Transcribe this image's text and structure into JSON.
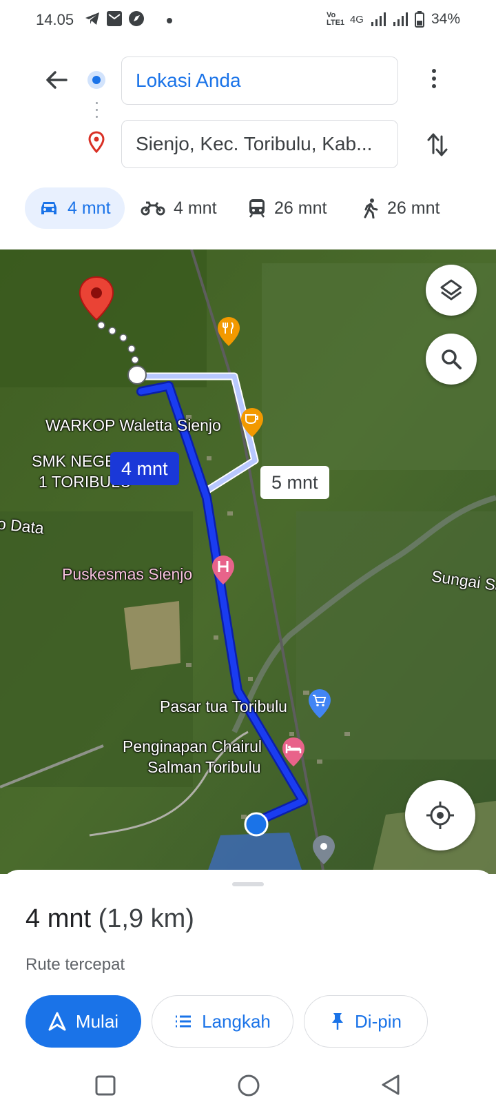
{
  "status_bar": {
    "time": "14.05",
    "network_label": "4G",
    "volte_label": "Vo LTE1",
    "battery": "34%"
  },
  "header": {
    "origin_value": "Lokasi Anda",
    "destination_value": "Sienjo, Kec. Toribulu, Kab..."
  },
  "modes": [
    {
      "icon": "car-icon",
      "label": "4 mnt",
      "active": true
    },
    {
      "icon": "motorcycle-icon",
      "label": "4 mnt",
      "active": false
    },
    {
      "icon": "train-icon",
      "label": "26 mnt",
      "active": false
    },
    {
      "icon": "walk-icon",
      "label": "26 mnt",
      "active": false
    }
  ],
  "map": {
    "labels": {
      "warkop": "WARKOP Waletta Sienjo",
      "smk_line1": "SMK NEGE",
      "smk_line2": "1 TORIBULU",
      "data": "o Data",
      "puskesmas": "Puskesmas Sienjo",
      "sungai": "Sungai Sa",
      "pasar": "Pasar tua Toribulu",
      "penginapan_line1": "Penginapan Chairul",
      "penginapan_line2": "Salman Toribulu"
    },
    "route_primary_label": "4 mnt",
    "route_alt_label": "5 mnt",
    "colors": {
      "route": "#1a3cf0",
      "route_alt": "#b8c8ff"
    }
  },
  "sheet": {
    "duration": "4 mnt",
    "distance": "(1,9 km)",
    "subtitle": "Rute tercepat",
    "start_label": "Mulai",
    "steps_label": "Langkah",
    "pin_label": "Di-pin"
  },
  "colors": {
    "accent": "#1a73e8",
    "accent_light": "#e8f0fe",
    "destination_pin": "#d93025"
  }
}
